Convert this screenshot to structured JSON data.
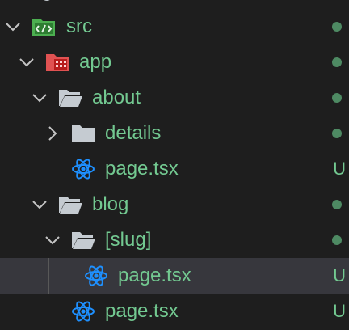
{
  "explorer": {
    "accent": {
      "git_added": "#73c991",
      "git_dot": "#4e8a63",
      "folder_gray": "#c5cbd1",
      "src_green": "#4caf50",
      "app_red": "#e05252",
      "react_blue": "#1e90ff"
    },
    "rows": [
      {
        "label": "src",
        "chevron": "chevron-down-icon",
        "icon": "src-folder-icon",
        "status": "dot"
      },
      {
        "label": "app",
        "chevron": "chevron-down-icon",
        "icon": "app-folder-icon",
        "status": "dot"
      },
      {
        "label": "about",
        "chevron": "chevron-down-icon",
        "icon": "folder-open-icon",
        "status": "dot"
      },
      {
        "label": "details",
        "chevron": "chevron-right-icon",
        "icon": "folder-closed-icon",
        "status": "dot"
      },
      {
        "label": "page.tsx",
        "chevron": "",
        "icon": "react-icon",
        "status": "U"
      },
      {
        "label": "blog",
        "chevron": "chevron-down-icon",
        "icon": "folder-open-icon",
        "status": "dot"
      },
      {
        "label": "[slug]",
        "chevron": "chevron-down-icon",
        "icon": "folder-open-icon",
        "status": "dot"
      },
      {
        "label": "page.tsx",
        "chevron": "",
        "icon": "react-icon",
        "status": "U",
        "selected": true
      },
      {
        "label": "page.tsx",
        "chevron": "",
        "icon": "react-icon",
        "status": "U"
      }
    ]
  }
}
